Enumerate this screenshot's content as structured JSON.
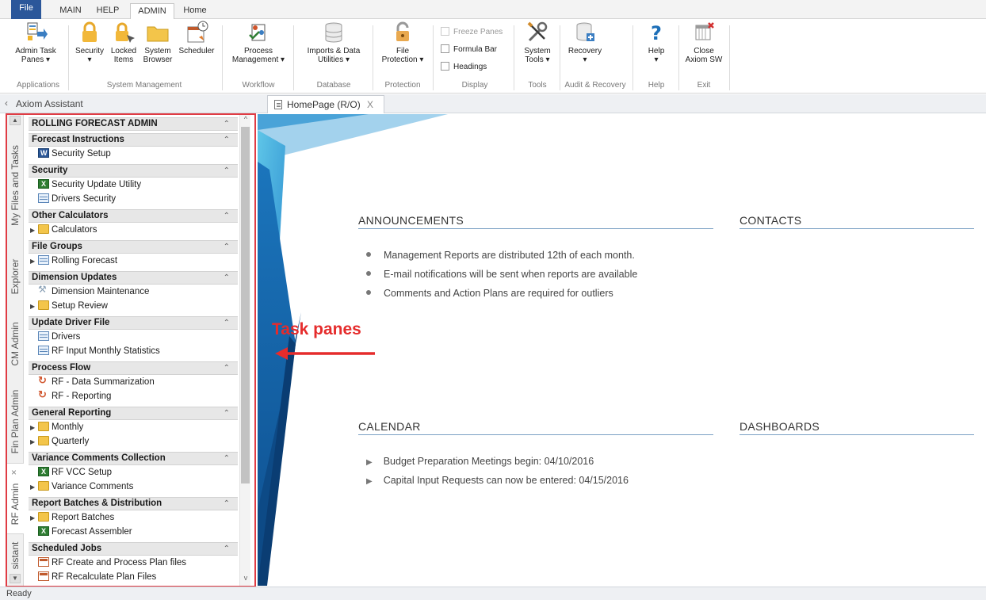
{
  "ribbon_tabs": [
    "File",
    "MAIN",
    "HELP",
    "ADMIN",
    "Home"
  ],
  "ribbon": {
    "buttons": {
      "admin_task_panes": "Admin Task\nPanes ▾",
      "security": "Security\n▾",
      "locked_items": "Locked\nItems",
      "system_browser": "System\nBrowser",
      "scheduler": "Scheduler",
      "process_management": "Process\nManagement ▾",
      "imports_data_utilities": "Imports & Data\nUtilities ▾",
      "file_protection": "File\nProtection ▾",
      "system_tools": "System\nTools ▾",
      "recovery": "Recovery\n▾",
      "help": "Help\n▾",
      "close_axiom": "Close\nAxiom SW"
    },
    "checkboxes": {
      "freeze_panes": "Freeze Panes",
      "formula_bar": "Formula Bar",
      "headings": "Headings"
    },
    "groups": {
      "applications": "Applications",
      "system_management": "System Management",
      "workflow": "Workflow",
      "database": "Database",
      "protection": "Protection",
      "display": "Display",
      "tools": "Tools",
      "audit_recovery": "Audit & Recovery",
      "help": "Help",
      "exit": "Exit"
    }
  },
  "assistant": {
    "collapse": "‹",
    "title": "Axiom Assistant"
  },
  "doc_tab": {
    "label": "HomePage (R/O)",
    "close": "X"
  },
  "vertical_tabs": [
    "My Files and Tasks",
    "Explorer",
    "CM Admin",
    "Fin Plan Admin",
    "RF Admin",
    "sistant"
  ],
  "vertical_tab_close": "×",
  "panel": {
    "title": "ROLLING FORECAST ADMIN",
    "sections": [
      {
        "title": "Forecast Instructions",
        "items": [
          {
            "label": "Security Setup",
            "icon": "word-icon",
            "tri": false
          }
        ]
      },
      {
        "title": "Security",
        "items": [
          {
            "label": "Security Update Utility",
            "icon": "excel-icon",
            "tri": false
          },
          {
            "label": "Drivers Security",
            "icon": "table-icon",
            "tri": false
          }
        ]
      },
      {
        "title": "Other Calculators",
        "items": [
          {
            "label": "Calculators",
            "icon": "folder-icon",
            "tri": true
          }
        ]
      },
      {
        "title": "File Groups",
        "items": [
          {
            "label": "Rolling Forecast",
            "icon": "table-icon",
            "tri": true
          }
        ]
      },
      {
        "title": "Dimension Updates",
        "items": [
          {
            "label": "Dimension Maintenance",
            "icon": "wrench-icon",
            "tri": false
          },
          {
            "label": "Setup Review",
            "icon": "folder-icon",
            "tri": true
          }
        ]
      },
      {
        "title": "Update Driver File",
        "items": [
          {
            "label": "Drivers",
            "icon": "table-icon",
            "tri": false
          },
          {
            "label": "RF Input Monthly Statistics",
            "icon": "table-icon",
            "tri": false
          }
        ]
      },
      {
        "title": "Process Flow",
        "items": [
          {
            "label": "RF - Data Summarization",
            "icon": "flow-icon",
            "tri": false
          },
          {
            "label": "RF - Reporting",
            "icon": "flow-icon",
            "tri": false
          }
        ]
      },
      {
        "title": "General Reporting",
        "items": [
          {
            "label": "Monthly",
            "icon": "folder-icon",
            "tri": true
          },
          {
            "label": "Quarterly",
            "icon": "folder-icon",
            "tri": true
          }
        ]
      },
      {
        "title": "Variance Comments Collection",
        "items": [
          {
            "label": "RF VCC Setup",
            "icon": "excel-icon",
            "tri": false
          },
          {
            "label": "Variance Comments",
            "icon": "folder-icon",
            "tri": true
          }
        ]
      },
      {
        "title": "Report Batches & Distribution",
        "items": [
          {
            "label": "Report Batches",
            "icon": "folder-icon",
            "tri": true
          },
          {
            "label": "Forecast Assembler",
            "icon": "excel-icon",
            "tri": false
          }
        ]
      },
      {
        "title": "Scheduled Jobs",
        "items": [
          {
            "label": "RF Create and Process Plan files",
            "icon": "scheduler-icon",
            "tri": false
          },
          {
            "label": "RF Recalculate Plan Files",
            "icon": "scheduler-icon",
            "tri": false
          }
        ]
      }
    ]
  },
  "home": {
    "announcements_title": "ANNOUNCEMENTS",
    "announcements": [
      "Management Reports are distributed 12th of each month.",
      "E-mail notifications will be sent when reports are available",
      "Comments and Action Plans are required for outliers"
    ],
    "contacts_title": "CONTACTS",
    "calendar_title": "CALENDAR",
    "calendar": [
      "Budget Preparation Meetings begin: 04/10/2016",
      "Capital Input Requests can now be entered: 04/15/2016"
    ],
    "dashboards_title": "DASHBOARDS"
  },
  "annotation": "Task panes",
  "status": "Ready",
  "colors": {
    "file_tab": "#2b579a",
    "highlight": "#e03c44",
    "annotation": "#e52c2c",
    "accent_blue": "#1d6fb8"
  }
}
